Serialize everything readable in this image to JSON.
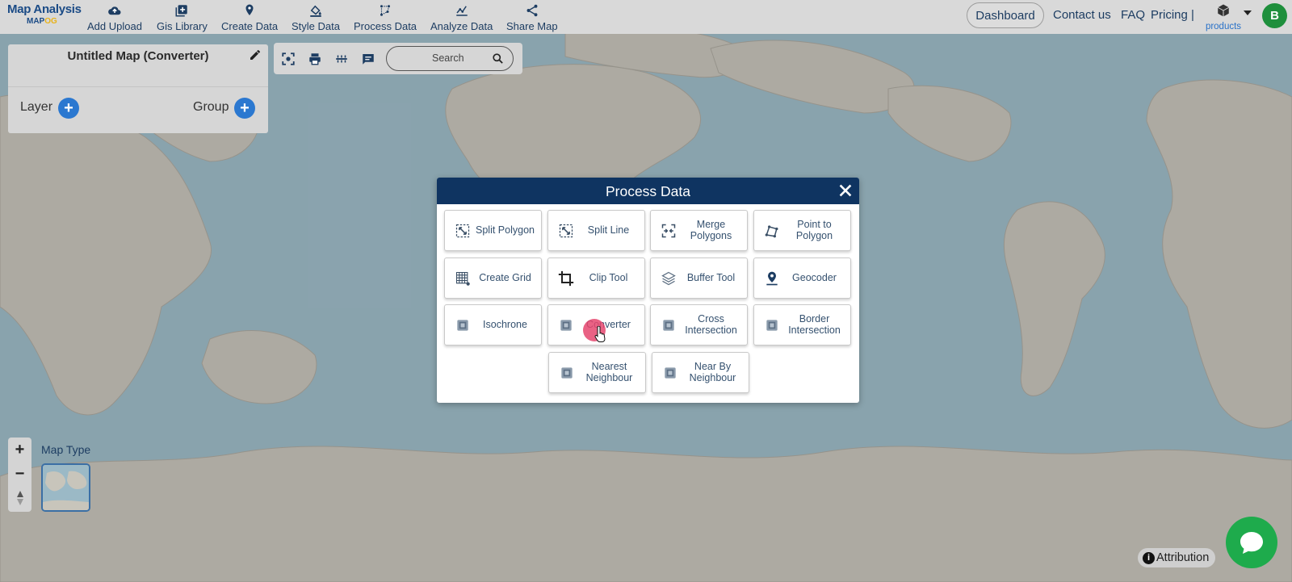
{
  "brand": {
    "title": "Map Analysis",
    "sub_main": "MAP",
    "sub_accent": "OG"
  },
  "nav": [
    {
      "label": "Add Upload",
      "icon": "cloud-upload-icon"
    },
    {
      "label": "Gis Library",
      "icon": "library-add-icon"
    },
    {
      "label": "Create Data",
      "icon": "location-pin-icon"
    },
    {
      "label": "Style Data",
      "icon": "paint-bucket-icon"
    },
    {
      "label": "Process Data",
      "icon": "process-nodes-icon"
    },
    {
      "label": "Analyze Data",
      "icon": "analyze-chart-icon"
    },
    {
      "label": "Share Map",
      "icon": "share-icon"
    }
  ],
  "topbar": {
    "dashboard": "Dashboard",
    "contact": "Contact us",
    "faq": "FAQ",
    "pricing": "Pricing |",
    "products": "products",
    "avatar": "B"
  },
  "panel": {
    "map_title": "Untitled Map (Converter)",
    "layer_label": "Layer",
    "group_label": "Group"
  },
  "search": {
    "placeholder": "Search"
  },
  "modal": {
    "title": "Process Data",
    "tools": [
      {
        "label": "Split Polygon",
        "icon": "split-polygon-icon"
      },
      {
        "label": "Split Line",
        "icon": "split-line-icon"
      },
      {
        "label": "Merge Polygons",
        "icon": "merge-polygons-icon"
      },
      {
        "label": "Point to Polygon",
        "icon": "point-to-polygon-icon"
      },
      {
        "label": "Create Grid",
        "icon": "create-grid-icon"
      },
      {
        "label": "Clip Tool",
        "icon": "crop-icon"
      },
      {
        "label": "Buffer Tool",
        "icon": "layers-icon"
      },
      {
        "label": "Geocoder",
        "icon": "geocoder-pin-icon"
      },
      {
        "label": "Isochrone",
        "icon": "isochrone-icon"
      },
      {
        "label": "Converter",
        "icon": "converter-icon"
      },
      {
        "label": "Cross Intersection",
        "icon": "cross-intersection-icon"
      },
      {
        "label": "Border Intersection",
        "icon": "border-intersection-icon"
      },
      {
        "label": "Nearest Neighbour",
        "icon": "nearest-neighbour-icon"
      },
      {
        "label": "Near By Neighbour",
        "icon": "near-by-neighbour-icon"
      }
    ]
  },
  "map_controls": {
    "zoom_in": "+",
    "zoom_out": "−",
    "map_type_label": "Map Type"
  },
  "attribution": "Attribution",
  "colors": {
    "navbar": "#d9d9d9",
    "brand": "#1b4b86",
    "modal_header": "#0f3461",
    "accent_blue": "#2b78d0",
    "avatar": "#1e8f3c",
    "chat": "#1eab4c",
    "click_indicator": "#e5466e"
  }
}
